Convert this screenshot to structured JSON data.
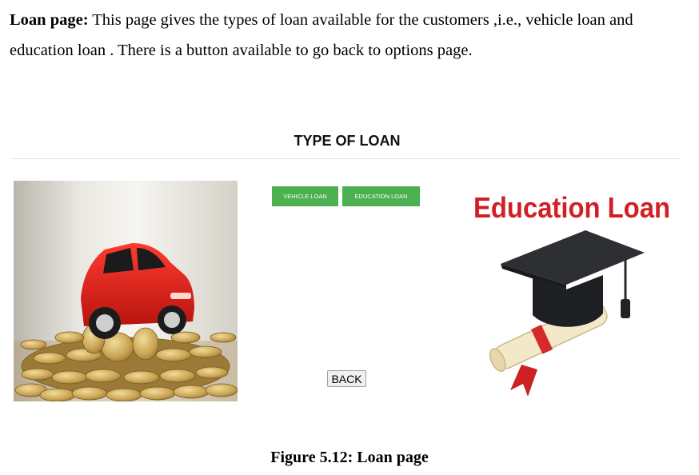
{
  "intro": {
    "heading": "Loan page:",
    "text": " This page gives the types of loan available for the customers ,i.e., vehicle loan and education loan . There is a button available to go back to options page."
  },
  "screenshot": {
    "title": "TYPE OF LOAN",
    "buttons": {
      "vehicle_loan": "VEHICLE LOAN",
      "education_loan": "EDUCATION LOAN",
      "back": "BACK"
    },
    "education_image_text": "Education Loan",
    "colors": {
      "button_green": "#4caf50",
      "education_text_red": "#d21f26"
    },
    "images": {
      "left": "car-on-coins-image",
      "right": "graduation-cap-diploma-image"
    }
  },
  "caption": "Figure 5.12: Loan page"
}
